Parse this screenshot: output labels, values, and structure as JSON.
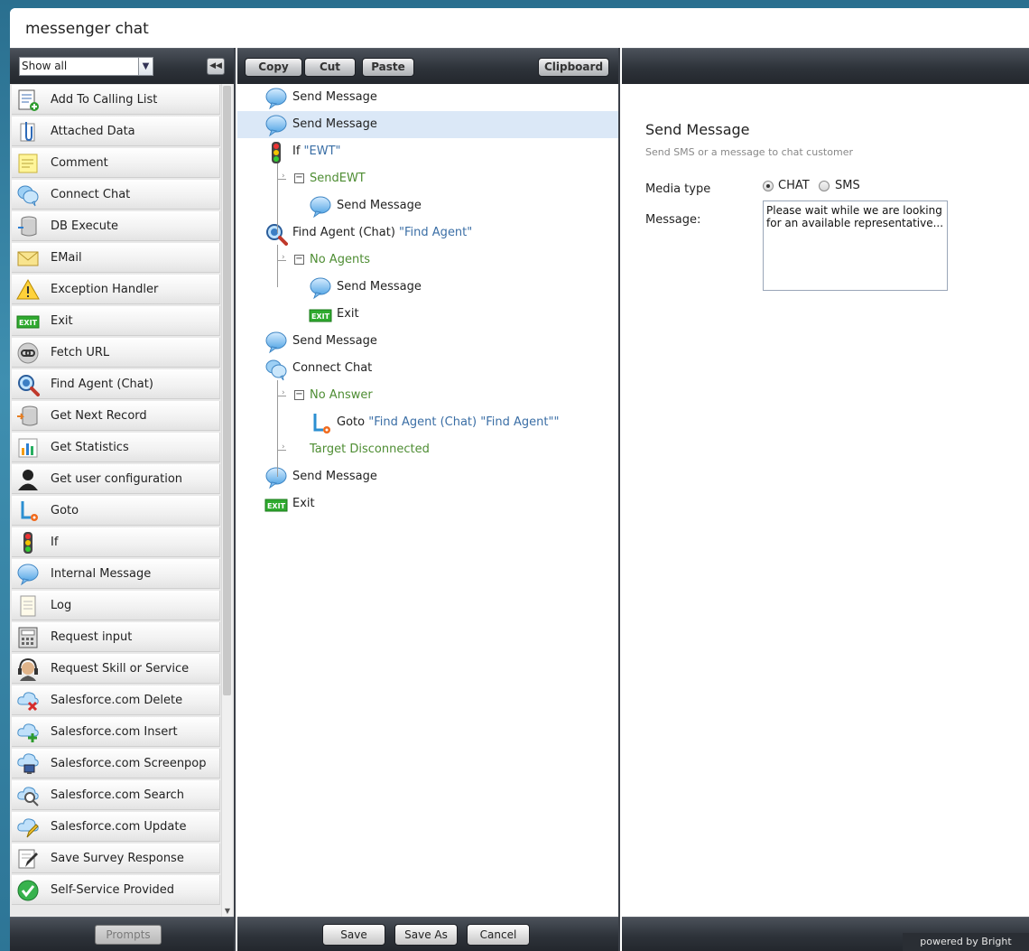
{
  "window": {
    "title": "messenger chat"
  },
  "palette": {
    "filter": "Show all",
    "items": [
      {
        "label": "Add To Calling List",
        "icon": "list-add-icon"
      },
      {
        "label": "Attached Data",
        "icon": "paperclip-icon"
      },
      {
        "label": "Comment",
        "icon": "sticky-note-icon"
      },
      {
        "label": "Connect Chat",
        "icon": "chat-bubbles-icon"
      },
      {
        "label": "DB Execute",
        "icon": "database-icon"
      },
      {
        "label": "EMail",
        "icon": "envelope-icon"
      },
      {
        "label": "Exception Handler",
        "icon": "warning-icon"
      },
      {
        "label": "Exit",
        "icon": "exit-icon"
      },
      {
        "label": "Fetch URL",
        "icon": "link-icon"
      },
      {
        "label": "Find Agent (Chat)",
        "icon": "magnifier-icon"
      },
      {
        "label": "Get Next Record",
        "icon": "database-next-icon"
      },
      {
        "label": "Get Statistics",
        "icon": "bar-chart-icon"
      },
      {
        "label": "Get user configuration",
        "icon": "user-silhouette-icon"
      },
      {
        "label": "Goto",
        "icon": "goto-arrow-icon"
      },
      {
        "label": "If",
        "icon": "traffic-light-icon"
      },
      {
        "label": "Internal Message",
        "icon": "speech-bubble-icon"
      },
      {
        "label": "Log",
        "icon": "notepad-icon"
      },
      {
        "label": "Request input",
        "icon": "keypad-icon"
      },
      {
        "label": "Request Skill or Service",
        "icon": "headset-icon"
      },
      {
        "label": "Salesforce.com Delete",
        "icon": "cloud-delete-icon"
      },
      {
        "label": "Salesforce.com Insert",
        "icon": "cloud-add-icon"
      },
      {
        "label": "Salesforce.com Screenpop",
        "icon": "cloud-monitor-icon"
      },
      {
        "label": "Salesforce.com Search",
        "icon": "cloud-search-icon"
      },
      {
        "label": "Salesforce.com Update",
        "icon": "cloud-edit-icon"
      },
      {
        "label": "Save Survey Response",
        "icon": "survey-pencil-icon"
      },
      {
        "label": "Self-Service Provided",
        "icon": "check-circle-icon"
      }
    ],
    "prompts_label": "Prompts"
  },
  "toolbar": {
    "copy": "Copy",
    "cut": "Cut",
    "paste": "Paste",
    "clipboard": "Clipboard"
  },
  "flow": {
    "rows": [
      {
        "kind": "step",
        "icon": "speech-bubble-icon",
        "text": "Send Message",
        "quoted": ""
      },
      {
        "kind": "step",
        "icon": "speech-bubble-icon",
        "text": "Send Message",
        "quoted": "",
        "selected": true
      },
      {
        "kind": "step",
        "icon": "traffic-light-icon",
        "text": "If ",
        "quoted": "\"EWT\""
      },
      {
        "kind": "branch",
        "text": "SendEWT",
        "expander": "−"
      },
      {
        "kind": "step",
        "icon": "speech-bubble-icon",
        "text": "Send Message",
        "quoted": "",
        "indent": 2
      },
      {
        "kind": "step",
        "icon": "magnifier-icon",
        "text": "Find Agent (Chat) ",
        "quoted": "\"Find Agent\""
      },
      {
        "kind": "branch",
        "text": "No Agents",
        "expander": "−"
      },
      {
        "kind": "step",
        "icon": "speech-bubble-icon",
        "text": "Send Message",
        "quoted": "",
        "indent": 2
      },
      {
        "kind": "step",
        "icon": "exit-icon",
        "text": "Exit",
        "quoted": "",
        "indent": 2
      },
      {
        "kind": "step",
        "icon": "speech-bubble-icon",
        "text": "Send Message",
        "quoted": ""
      },
      {
        "kind": "step",
        "icon": "chat-bubbles-icon",
        "text": "Connect Chat",
        "quoted": ""
      },
      {
        "kind": "branch",
        "text": "No Answer",
        "expander": "−"
      },
      {
        "kind": "step",
        "icon": "goto-arrow-icon",
        "text": "Goto ",
        "quoted": "\"Find Agent (Chat) \"Find Agent\"\"",
        "indent": 2
      },
      {
        "kind": "branch",
        "text": "Target Disconnected",
        "expander": ""
      },
      {
        "kind": "step",
        "icon": "speech-bubble-icon",
        "text": "Send Message",
        "quoted": ""
      },
      {
        "kind": "step",
        "icon": "exit-icon",
        "text": "Exit",
        "quoted": ""
      }
    ],
    "save": "Save",
    "save_as": "Save As",
    "cancel": "Cancel"
  },
  "properties": {
    "title": "Send Message",
    "subtitle": "Send SMS or a message to chat customer",
    "media_type_label": "Media type",
    "media_options": [
      {
        "label": "CHAT",
        "checked": true
      },
      {
        "label": "SMS",
        "checked": false
      }
    ],
    "message_label": "Message:",
    "message_value": "Please wait while we are looking for an available representative..."
  },
  "footer": {
    "powered_by": "powered by Bright Pattern"
  },
  "colors": {
    "accent_branch": "#4e8d33",
    "accent_quoted": "#3a6ea5",
    "selected_row": "#dbe8f7"
  }
}
